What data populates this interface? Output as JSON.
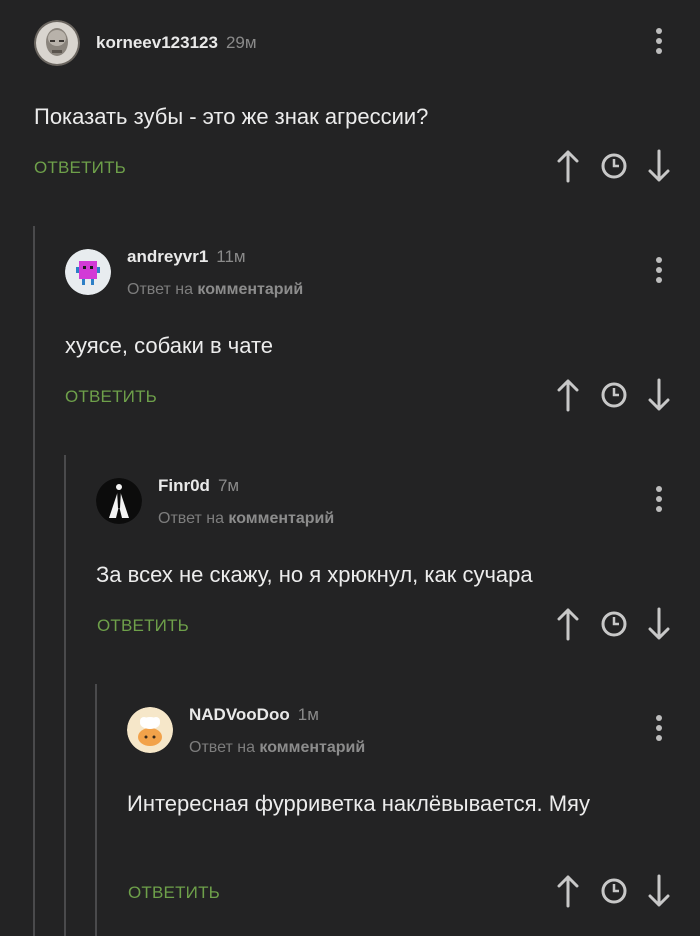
{
  "comments": [
    {
      "username": "korneev123123",
      "time": "29м",
      "text": "Показать зубы - это же знак агрессии?",
      "reply_label": "ОТВЕТИТЬ"
    },
    {
      "username": "andreyvr1",
      "time": "11м",
      "reply_prefix": "Ответ на",
      "reply_target": "комментарий",
      "text": "хуясе, собаки в чате",
      "reply_label": "ОТВЕТИТЬ"
    },
    {
      "username": "Finr0d",
      "time": "7м",
      "reply_prefix": "Ответ на",
      "reply_target": "комментарий",
      "text": "За всех не скажу, но я хрюкнул, как сучара",
      "reply_label": "ОТВЕТИТЬ"
    },
    {
      "username": "NADVooDoo",
      "time": "1м",
      "reply_prefix": "Ответ на",
      "reply_target": "комментарий",
      "text": "Интересная фурриветка наклёвывается. Мяу",
      "reply_label": "ОТВЕТИТЬ"
    }
  ],
  "icons": {
    "upvote": "arrow-up-icon",
    "save": "clock-icon",
    "downvote": "arrow-down-icon",
    "more": "more-vertical-icon"
  },
  "colors": {
    "background": "#232324",
    "reply_green": "#6ea04a",
    "thread_line": "#4a4a4c"
  }
}
